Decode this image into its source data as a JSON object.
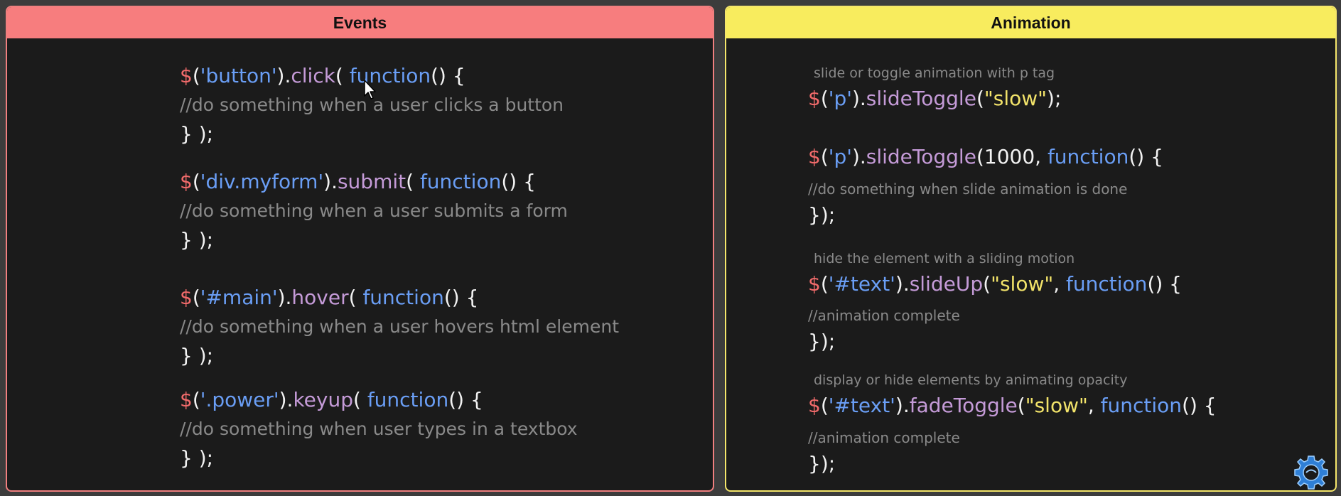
{
  "events": {
    "title": "Events",
    "blocks": [
      {
        "dollar": "$",
        "open": "(",
        "selector": "'button'",
        "close_dot": ").",
        "method": "click",
        "paren_sp": "( ",
        "fn": "function",
        "tail": "() {",
        "comment": "//do something when a user clicks a button",
        "end": "} );"
      },
      {
        "dollar": "$",
        "open": "(",
        "selector": "'div.myform'",
        "close_dot": ").",
        "method": "submit",
        "paren_sp": "( ",
        "fn": "function",
        "tail": "() {",
        "comment": "//do something when a user submits a form",
        "end": "} );"
      },
      {
        "dollar": "$",
        "open": "(",
        "selector": "'#main'",
        "close_dot": ").",
        "method": "hover",
        "paren_sp": "( ",
        "fn": "function",
        "tail": "() {",
        "comment": "//do something when a user hovers html element",
        "end": "} );"
      },
      {
        "dollar": "$",
        "open": "(",
        "selector": "'.power'",
        "close_dot": ").",
        "method": "keyup",
        "paren_sp": "( ",
        "fn": "function",
        "tail": "() {",
        "comment": "//do something when user types in a textbox",
        "end": "} );"
      }
    ]
  },
  "animation": {
    "title": "Animation",
    "desc1": "slide or toggle animation with p tag",
    "line1": {
      "dollar": "$",
      "open": "(",
      "selector": "'p'",
      "close_dot": ").",
      "method": "slideToggle",
      "paren": "(",
      "arg": "\"slow\"",
      "end": ");"
    },
    "line2": {
      "dollar": "$",
      "open": "(",
      "selector": "'p'",
      "close_dot": ").",
      "method": "slideToggle",
      "paren": "(",
      "num": "1000, ",
      "fn": "function",
      "tail": "() {"
    },
    "comment2": "//do something when slide animation is done",
    "end2": "});",
    "desc3": "hide the element with a sliding motion",
    "line3": {
      "dollar": "$",
      "open": "(",
      "selector": "'#text'",
      "close_dot": ").",
      "method": "slideUp",
      "paren": "(",
      "arg": "\"slow\"",
      "comma": ", ",
      "fn": "function",
      "tail": "() {"
    },
    "comment3": "//animation complete",
    "end3": "});",
    "desc4": "display or hide elements by animating opacity",
    "line4": {
      "dollar": "$",
      "open": "(",
      "selector": "'#text'",
      "close_dot": ").",
      "method": "fadeToggle",
      "paren": "(",
      "arg": "\"slow\"",
      "comma": ", ",
      "fn": "function",
      "tail": "() {"
    },
    "comment4": "//animation complete",
    "end4": "});"
  },
  "colors": {
    "events_header": "#f77d7e",
    "animation_header": "#f8ec5e",
    "background": "#1b1b1b",
    "selector": "#6a9ef5",
    "method": "#c59bd8",
    "dollar": "#f26b6b",
    "string": "#f2e36a",
    "comment": "#8a8a8a"
  },
  "icons": {
    "cursor": "mouse-pointer-icon",
    "logo": "gear-logo-icon"
  }
}
